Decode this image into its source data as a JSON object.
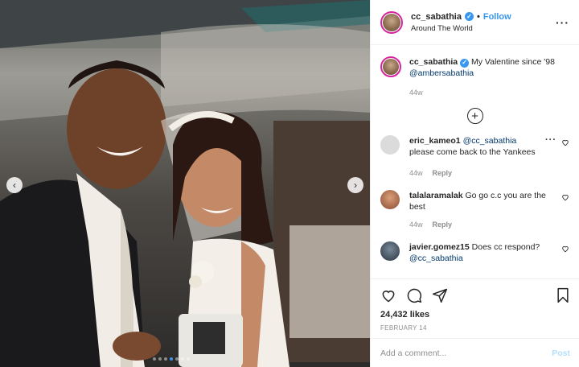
{
  "post": {
    "photo_alt": "Wedding photo in a car",
    "carousel": {
      "prev_icon": "chevron-left-icon",
      "next_icon": "chevron-right-icon",
      "slide_count": 7,
      "active_index": 3
    }
  },
  "header": {
    "username": "cc_sabathia",
    "follow_label": "Follow",
    "separator": "•",
    "location": "Around The World",
    "more_icon": "more-horizontal-icon"
  },
  "caption": {
    "username": "cc_sabathia",
    "text": "My Valentine since '98",
    "mention": "@ambersabathia",
    "time": "44w"
  },
  "load_more_icon": "plus-circle-icon",
  "comments": [
    {
      "username": "eric_kameo1",
      "mention": "@cc_sabathia",
      "text": "please come back to the Yankees",
      "time": "44w",
      "reply": "Reply",
      "avatar_color": "#dbdbdb"
    },
    {
      "username": "talalaramalak",
      "mention": "",
      "text": "Go go c.c you are the best",
      "time": "44w",
      "reply": "Reply",
      "avatar_color": "#b87a5a"
    },
    {
      "username": "javier.gomez15",
      "mention": "@cc_sabathia",
      "text": "Does cc respond?",
      "time": "",
      "reply": "",
      "avatar_color": "#4a5a6a"
    }
  ],
  "actions": {
    "likes": "24,432 likes",
    "date": "FEBRUARY 14"
  },
  "add_comment": {
    "placeholder": "Add a comment...",
    "post_label": "Post"
  },
  "colors": {
    "accent": "#3897f0",
    "muted": "#8e8e8e",
    "text": "#262626"
  }
}
